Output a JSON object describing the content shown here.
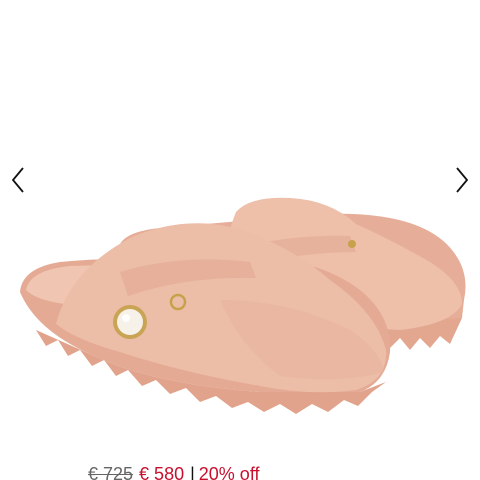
{
  "gallery": {
    "product_image": "beige suede slip-on clogs with pearl button strap",
    "prev_icon": "chevron-left-icon",
    "next_icon": "chevron-right-icon"
  },
  "price": {
    "original": "€ 725",
    "current": "€ 580",
    "separator": "|",
    "discount": "20% off"
  },
  "colors": {
    "sale": "#c8102e",
    "strikethrough": "#666666",
    "product_suede": "#ecbda7",
    "background": "#ffffff"
  }
}
